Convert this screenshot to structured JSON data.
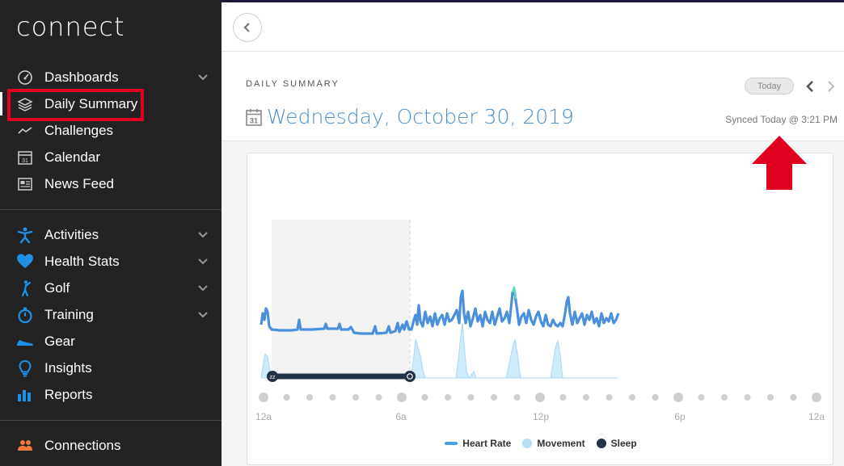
{
  "app": {
    "logo": "connect"
  },
  "sidebar": {
    "group1": [
      {
        "label": "Dashboards",
        "icon": "gauge-icon",
        "chevron": true
      },
      {
        "label": "Daily Summary",
        "icon": "layers-icon",
        "chevron": false,
        "active": true
      },
      {
        "label": "Challenges",
        "icon": "trend-icon",
        "chevron": false
      },
      {
        "label": "Calendar",
        "icon": "calendar-icon",
        "chevron": false
      },
      {
        "label": "News Feed",
        "icon": "newspaper-icon",
        "chevron": false
      }
    ],
    "group2": [
      {
        "label": "Activities",
        "icon": "runner-icon",
        "chevron": true
      },
      {
        "label": "Health Stats",
        "icon": "heart-icon",
        "chevron": true
      },
      {
        "label": "Golf",
        "icon": "golfer-icon",
        "chevron": true
      },
      {
        "label": "Training",
        "icon": "stopwatch-icon",
        "chevron": true
      },
      {
        "label": "Gear",
        "icon": "shoe-icon",
        "chevron": false
      },
      {
        "label": "Insights",
        "icon": "lightbulb-icon",
        "chevron": false
      },
      {
        "label": "Reports",
        "icon": "bar-chart-icon",
        "chevron": false
      }
    ],
    "group3": [
      {
        "label": "Connections",
        "icon": "people-icon",
        "chevron": false
      }
    ]
  },
  "summary": {
    "section_label": "DAILY SUMMARY",
    "calendar_day": "31",
    "date": "Wednesday, October 30, 2019",
    "today_label": "Today",
    "synced": "Synced Today @ 3:21 PM"
  },
  "chart": {
    "x_ticks": [
      "12a",
      "6a",
      "12p",
      "6p",
      "12a"
    ],
    "legend": [
      {
        "label": "Heart Rate",
        "color": "#4aa0dc",
        "kind": "line"
      },
      {
        "label": "Movement",
        "color": "#b3e0f7",
        "kind": "dot"
      },
      {
        "label": "Sleep",
        "color": "#243447",
        "kind": "dot"
      }
    ]
  },
  "colors": {
    "accent": "#4a90c9",
    "sidebar_bg": "#232323",
    "highlight": "#e00020"
  }
}
